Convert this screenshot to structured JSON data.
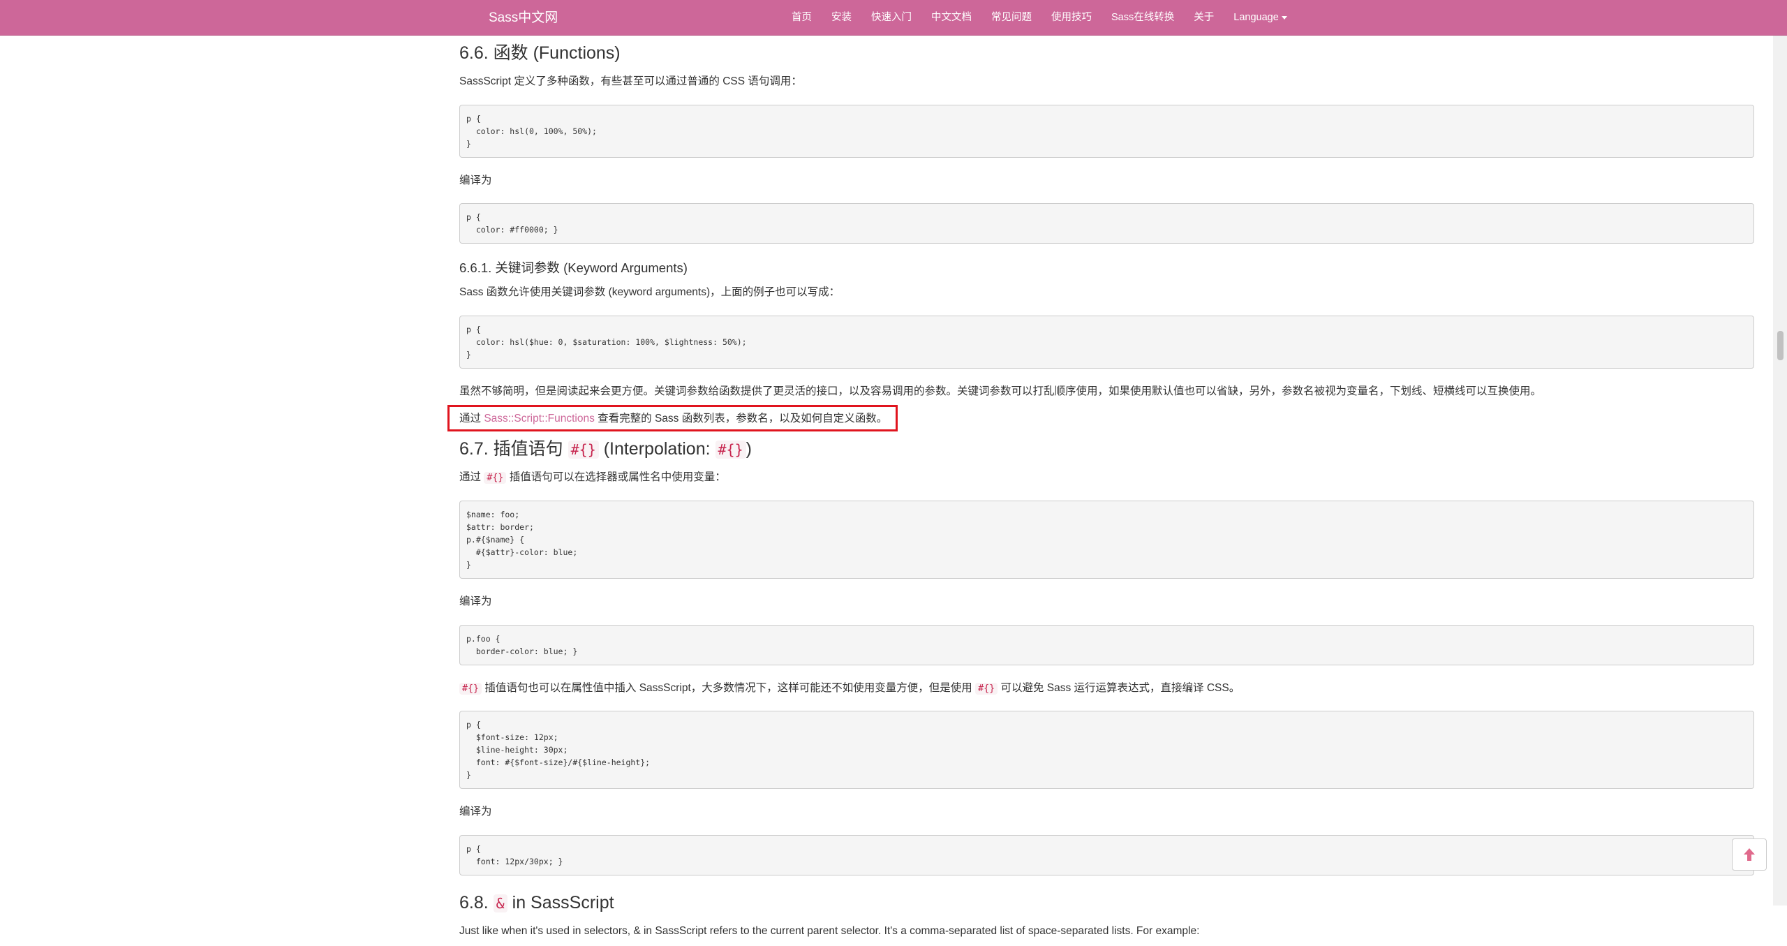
{
  "header": {
    "brand": "Sass中文网",
    "nav": [
      "首页",
      "安装",
      "快速入门",
      "中文文档",
      "常见问题",
      "使用技巧",
      "Sass在线转换",
      "关于"
    ],
    "language": "Language"
  },
  "colors": {
    "brand": "#cd6799",
    "highlight_border": "#e0141e",
    "inline_code": "#c7254e"
  },
  "icons": {
    "back_to_top": "arrow-up-icon"
  },
  "doc": {
    "s66_title": "6.6. 函数 (Functions)",
    "s66_intro": "SassScript 定义了多种函数，有些甚至可以通过普通的 CSS 语句调用：",
    "code1": "p {\n  color: hsl(0, 100%, 50%);\n}",
    "compiled_label_1": "编译为",
    "code2": "p {\n  color: #ff0000; }",
    "s661_title": "6.6.1. 关键词参数 (Keyword Arguments)",
    "s661_intro": "Sass 函数允许使用关键词参数 (keyword arguments)，上面的例子也可以写成：",
    "code3": "p {\n  color: hsl($hue: 0, $saturation: 100%, $lightness: 50%);\n}",
    "s661_desc": "虽然不够简明，但是阅读起来会更方便。关键词参数给函数提供了更灵活的接口，以及容易调用的参数。关键词参数可以打乱顺序使用，如果使用默认值也可以省缺，另外，参数名被视为变量名，下划线、短横线可以互换使用。",
    "ref_prefix": "通过",
    "ref_link": "Sass::Script::Functions",
    "ref_suffix": "查看完整的 Sass 函数列表，参数名，以及如何自定义函数。",
    "s67_title_a": "6.7. 插值语句",
    "s67_code_a": "#{}",
    "s67_title_b": "(Interpolation:",
    "s67_code_b": "#{}",
    "s67_title_c": ")",
    "s67_intro_a": "通过",
    "s67_intro_code": "#{}",
    "s67_intro_b": "插值语句可以在选择器或属性名中使用变量：",
    "code4": "$name: foo;\n$attr: border;\np.#{$name} {\n  #{$attr}-color: blue;\n}",
    "compiled_label_2": "编译为",
    "code5": "p.foo {\n  border-color: blue; }",
    "s67_desc_code1": "#{}",
    "s67_desc_a": "插值语句也可以在属性值中插入 SassScript，大多数情况下，这样可能还不如使用变量方便，但是使用",
    "s67_desc_code2": "#{}",
    "s67_desc_b": "可以避免 Sass 运行运算表达式，直接编译 CSS。",
    "code6": "p {\n  $font-size: 12px;\n  $line-height: 30px;\n  font: #{$font-size}/#{$line-height};\n}",
    "compiled_label_3": "编译为",
    "code7": "p {\n  font: 12px/30px; }",
    "s68_title_a": "6.8.",
    "s68_code": "&",
    "s68_title_b": "in SassScript",
    "s68_intro": "Just like when it's used in selectors, & in SassScript refers to the current parent selector. It's a comma-separated list of space-separated lists. For example:"
  }
}
